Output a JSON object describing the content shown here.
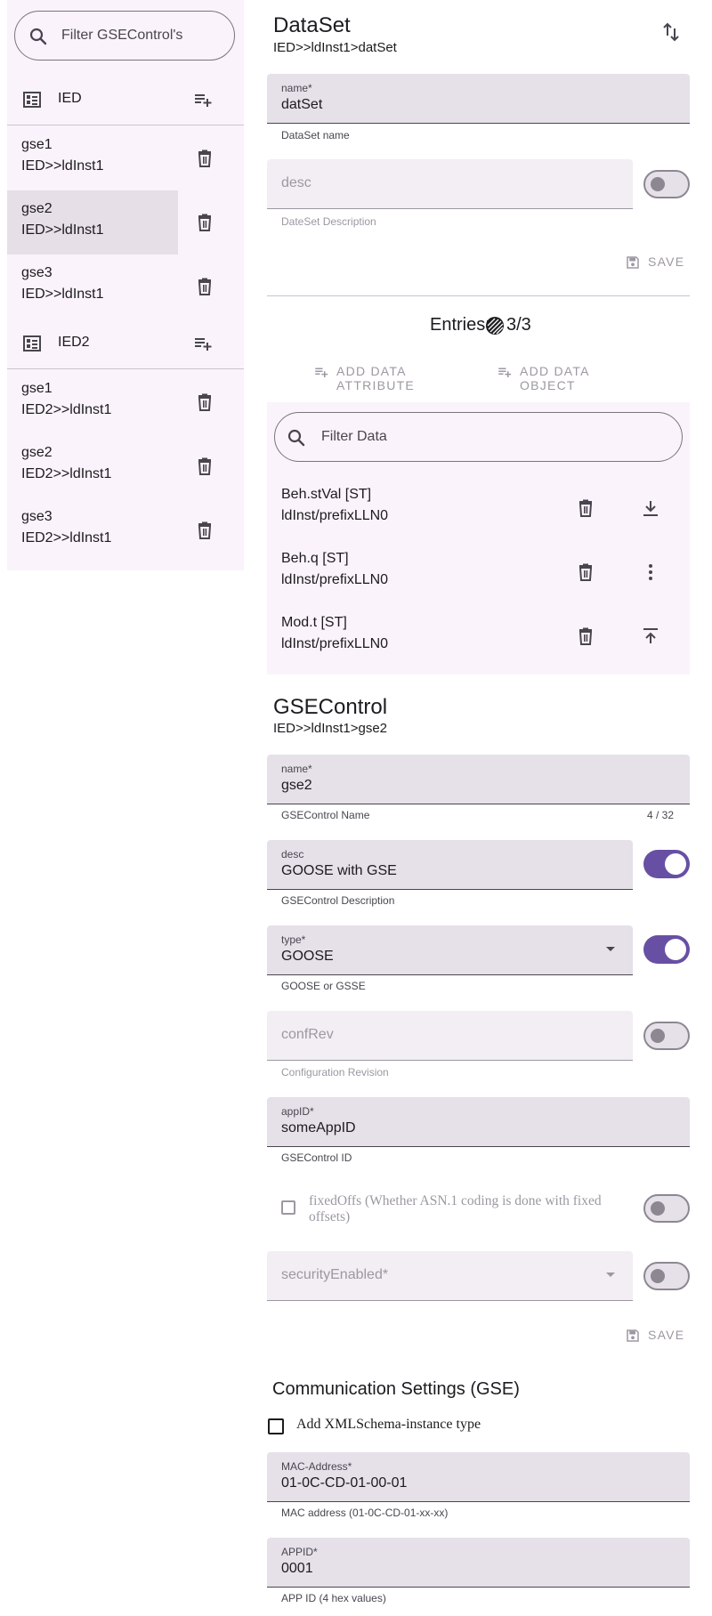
{
  "sidebar": {
    "filter_placeholder": "Filter GSEControl's",
    "groups": [
      {
        "ied": "IED",
        "items": [
          {
            "name": "gse1",
            "path": "IED>>ldInst1"
          },
          {
            "name": "gse2",
            "path": "IED>>ldInst1"
          },
          {
            "name": "gse3",
            "path": "IED>>ldInst1"
          }
        ]
      },
      {
        "ied": "IED2",
        "items": [
          {
            "name": "gse1",
            "path": "IED2>>ldInst1"
          },
          {
            "name": "gse2",
            "path": "IED2>>ldInst1"
          },
          {
            "name": "gse3",
            "path": "IED2>>ldInst1"
          }
        ]
      }
    ]
  },
  "dataset": {
    "title": "DataSet",
    "path": "IED>>ldInst1>datSet",
    "name_label": "name*",
    "name_value": "datSet",
    "name_helper": "DataSet name",
    "desc_placeholder": "desc",
    "desc_helper": "DateSet Description",
    "save_label": "SAVE",
    "entries_label": "Entries:",
    "entries_count": "3/3",
    "add_attribute_label": "ADD DATA ATTRIBUTE",
    "add_object_label": "ADD DATA OBJECT",
    "filter_placeholder": "Filter Data",
    "entries": [
      {
        "name": "Beh.stVal [ST]",
        "path": "ldInst/prefixLLN0"
      },
      {
        "name": "Beh.q [ST]",
        "path": "ldInst/prefixLLN0"
      },
      {
        "name": "Mod.t [ST]",
        "path": "ldInst/prefixLLN0"
      }
    ]
  },
  "gsecontrol": {
    "title": "GSEControl",
    "path": "IED>>ldInst1>gse2",
    "name_label": "name*",
    "name_value": "gse2",
    "name_helper": "GSEControl Name",
    "name_counter": "4 / 32",
    "desc_label": "desc",
    "desc_value": "GOOSE with GSE",
    "desc_helper": "GSEControl Description",
    "type_label": "type*",
    "type_value": "GOOSE",
    "type_helper": "GOOSE or GSSE",
    "confrev_placeholder": "confRev",
    "confrev_helper": "Configuration Revision",
    "appid_label": "appID*",
    "appid_value": "someAppID",
    "appid_helper": "GSEControl ID",
    "fixedoffs_label": "fixedOffs (Whether ASN.1 coding is done with fixed offsets)",
    "security_placeholder": "securityEnabled*",
    "save_label": "SAVE"
  },
  "communication": {
    "title": "Communication Settings (GSE)",
    "xml_checkbox_label": "Add XMLSchema-instance type",
    "mac_label": "MAC-Address*",
    "mac_value": "01-0C-CD-01-00-01",
    "mac_helper": "MAC address (01-0C-CD-01-xx-xx)",
    "appid_label": "APPID*",
    "appid_value": "0001",
    "appid_helper": "APP ID (4 hex values)"
  },
  "colors": {
    "primary": "#6750a4",
    "surface_tint": "#fbf3fb",
    "field_fill": "#e6e0e9",
    "selected_item": "#e6dfe8"
  }
}
